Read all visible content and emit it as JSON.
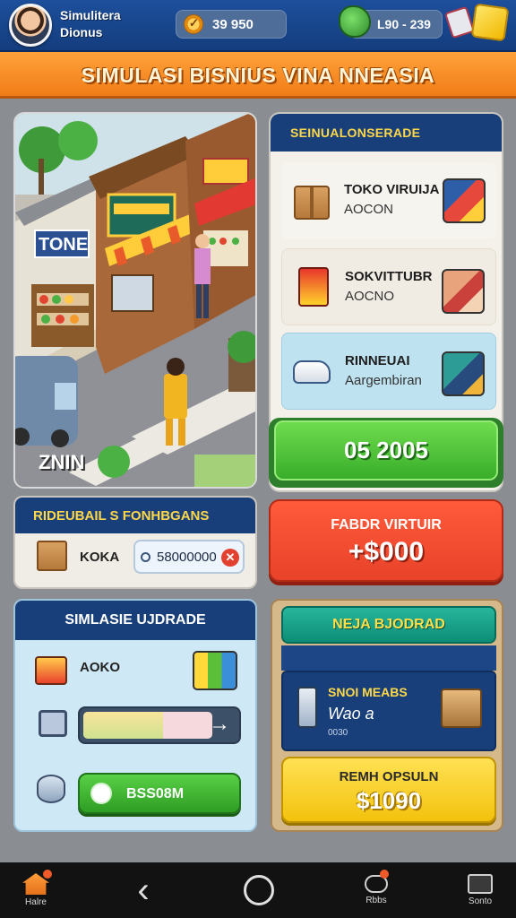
{
  "header": {
    "player_name_line1": "Simulitera",
    "player_name_line2": "Dionus",
    "coins": "39 950",
    "xp": "L90 - 239",
    "icons": [
      "avatar",
      "coin-icon",
      "gem-icon",
      "cards-icon",
      "cube-icon"
    ]
  },
  "banner": {
    "title": "SIMULASI BISNIUS VINA NNEASIA"
  },
  "scene": {
    "label": "ZNIN",
    "store_sign": "TONE"
  },
  "shop_panel": {
    "title": "SEINUALONSERADE",
    "items": [
      {
        "title": "TOKO VIRUIJA",
        "subtitle": "AOCON",
        "icon": "box-icon"
      },
      {
        "title": "SOKVITTUBR",
        "subtitle": "AOCNO",
        "icon": "product-icon"
      },
      {
        "title": "RINNEUAI",
        "subtitle": "Aargembiran",
        "icon": "car-icon"
      }
    ],
    "buy_button": "05 2005"
  },
  "reserve_panel": {
    "title": "RIDEUBAIL S FONHBGANS",
    "label": "KOKA",
    "input_value": "58000000"
  },
  "reward_button": {
    "title": "FABDR VIRTUIR",
    "amount": "+$000"
  },
  "upgrade_panel": {
    "title": "SIMLASIE UJDRADE",
    "label": "AOKO",
    "progress": 0.62,
    "collect_label": "BSS08M"
  },
  "deal_panel": {
    "tab_label": "NEJA BJODRAD",
    "card_title": "SNOI MEABS",
    "card_sub": "Wao a",
    "card_small": "0030",
    "claim_title": "REMH OPSULN",
    "claim_amount": "$1090"
  },
  "nav": {
    "home": "Halre",
    "messages": "Rbbs",
    "store": "Sonto"
  },
  "colors": {
    "header_blue": "#1d4f9c",
    "banner_orange": "#f58a22",
    "panel_navy": "#183f7a",
    "accent_green": "#38ad2a",
    "accent_red": "#e8432a",
    "accent_yellow": "#f3c20d",
    "accent_teal": "#0d8d76"
  }
}
